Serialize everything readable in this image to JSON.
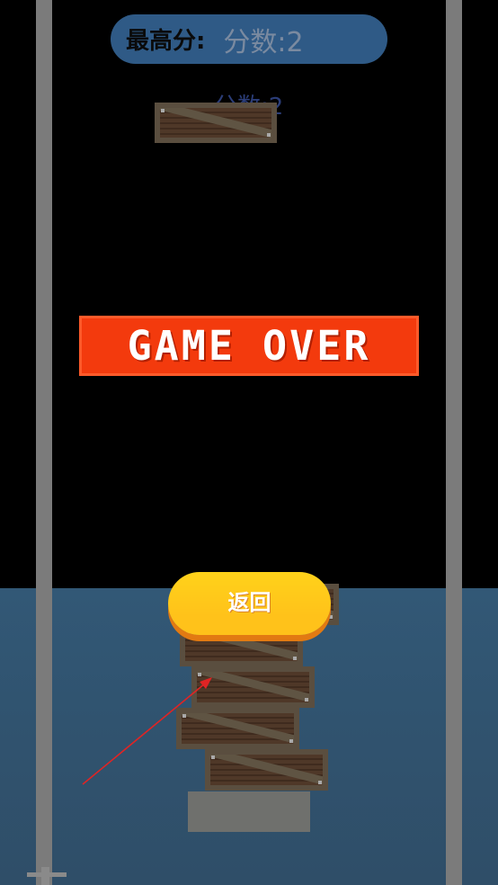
{
  "hud": {
    "best_label": "最高分:",
    "current_score": "分数:2",
    "ghost_score": "分数:2"
  },
  "overlay": {
    "game_over_text": "GAME OVER",
    "return_label": "返回"
  },
  "colors": {
    "background": "#000000",
    "sea": "#325876",
    "pole": "#7b7b7b",
    "score_pill": "#2f5a86",
    "game_over_banner": "#f33a0d",
    "return_button": "#ffc21a",
    "annotation_arrow": "#e02424"
  },
  "icons": {
    "annotation": "red-arrow-icon",
    "pole_base": "hook-icon"
  }
}
